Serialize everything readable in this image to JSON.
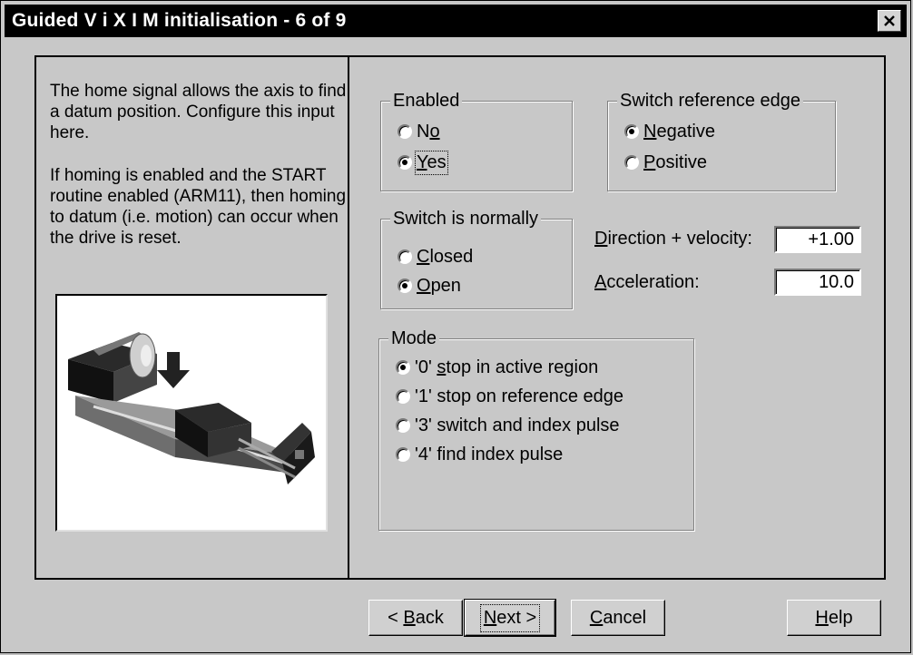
{
  "window": {
    "title": "Guided V i X I M initialisation - 6 of 9"
  },
  "description": {
    "para1": "The home signal allows the axis to find a datum position. Configure this input here.",
    "para2": "If homing is enabled and the START routine enabled (ARM11), then homing to datum (i.e. motion) can occur when the drive is reset."
  },
  "enabled_group": {
    "legend": "Enabled",
    "options": [
      {
        "label_ul": "",
        "label_rest": "N",
        "label_ul2": "o",
        "checked": false
      },
      {
        "label_ul": "Y",
        "label_rest": "es",
        "checked": true
      }
    ]
  },
  "switch_edge_group": {
    "legend": "Switch reference edge",
    "options": [
      {
        "label_ul": "N",
        "label_rest": "egative",
        "checked": true
      },
      {
        "label_ul": "P",
        "label_rest": "ositive",
        "checked": false
      }
    ]
  },
  "switch_normally_group": {
    "legend": "Switch is normally",
    "options": [
      {
        "label_ul": "C",
        "label_rest": "losed",
        "checked": false
      },
      {
        "label_ul": "O",
        "label_rest": "pen",
        "checked": true
      }
    ]
  },
  "direction_velocity": {
    "label_ul": "D",
    "label_rest": "irection + velocity:",
    "value": "+1.00"
  },
  "acceleration": {
    "label_ul": "A",
    "label_rest": "cceleration:",
    "value": "10.0"
  },
  "mode_group": {
    "legend": "Mode",
    "options": [
      {
        "label_pre": "'0' ",
        "label_ul": "s",
        "label_rest": "top in active region",
        "checked": true
      },
      {
        "label_pre": "'1' stop on reference edge",
        "label_ul": "",
        "label_rest": "",
        "checked": false
      },
      {
        "label_pre": "'3' switch and index pulse",
        "label_ul": "",
        "label_rest": "",
        "checked": false
      },
      {
        "label_pre": "'4' find index pulse",
        "label_ul": "",
        "label_rest": "",
        "checked": false
      }
    ]
  },
  "buttons": {
    "back_pre": "< ",
    "back_ul": "B",
    "back_rest": "ack",
    "next_ul": "N",
    "next_rest": "ext >",
    "cancel_ul": "C",
    "cancel_rest": "ancel",
    "help_ul": "H",
    "help_rest": "elp"
  },
  "icons": {
    "close": "close-x-icon",
    "picture": "linear-actuator-illustration"
  }
}
